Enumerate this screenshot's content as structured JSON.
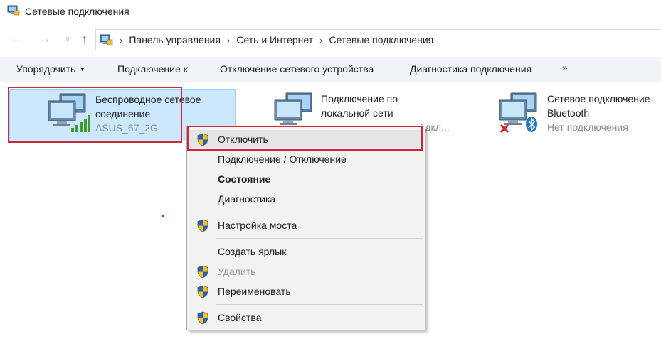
{
  "window": {
    "title": "Сетевые подключения"
  },
  "address": {
    "crumbs": [
      "Панель управления",
      "Сеть и Интернет",
      "Сетевые подключения"
    ]
  },
  "toolbar": {
    "organize": "Упорядочить",
    "connect_to": "Подключение к",
    "disable_device": "Отключение сетевого устройства",
    "diagnose": "Диагностика подключения",
    "more": "»"
  },
  "connections": [
    {
      "name_line1": "Беспроводное сетевое",
      "name_line2": "соединение",
      "status": "ASUS_67_2G",
      "icon": "wifi-monitor-icon"
    },
    {
      "name_line1": "Подключение по",
      "name_line2": "локальной сети",
      "status": "Сетевой кабель не подкл...",
      "status_visible": "бдкл...",
      "icon": "ethernet-monitor-icon"
    },
    {
      "name_line1": "Сетевое подключение",
      "name_line2": "Bluetooth",
      "status": "Нет подключения",
      "icon": "bluetooth-monitor-icon"
    }
  ],
  "context_menu": {
    "items": [
      {
        "label": "Отключить",
        "shield": true,
        "disabled": false,
        "bold": false
      },
      {
        "label": "Подключение / Отключение",
        "shield": false,
        "disabled": false,
        "bold": false
      },
      {
        "label": "Состояние",
        "shield": false,
        "disabled": false,
        "bold": true
      },
      {
        "label": "Диагностика",
        "shield": false,
        "disabled": false,
        "bold": false
      },
      {
        "label": "Настройка моста",
        "shield": true,
        "disabled": false,
        "bold": false
      },
      {
        "label": "Создать ярлык",
        "shield": false,
        "disabled": false,
        "bold": false
      },
      {
        "label": "Удалить",
        "shield": true,
        "disabled": true,
        "bold": false
      },
      {
        "label": "Переименовать",
        "shield": true,
        "disabled": false,
        "bold": false
      },
      {
        "label": "Свойства",
        "shield": true,
        "disabled": false,
        "bold": false
      }
    ]
  },
  "colors": {
    "selection_bg": "#cce8ff",
    "highlight_red": "#d0283a",
    "toolbar_bg": "#f0f4f9",
    "bluetooth_blue": "#1c78d0"
  }
}
